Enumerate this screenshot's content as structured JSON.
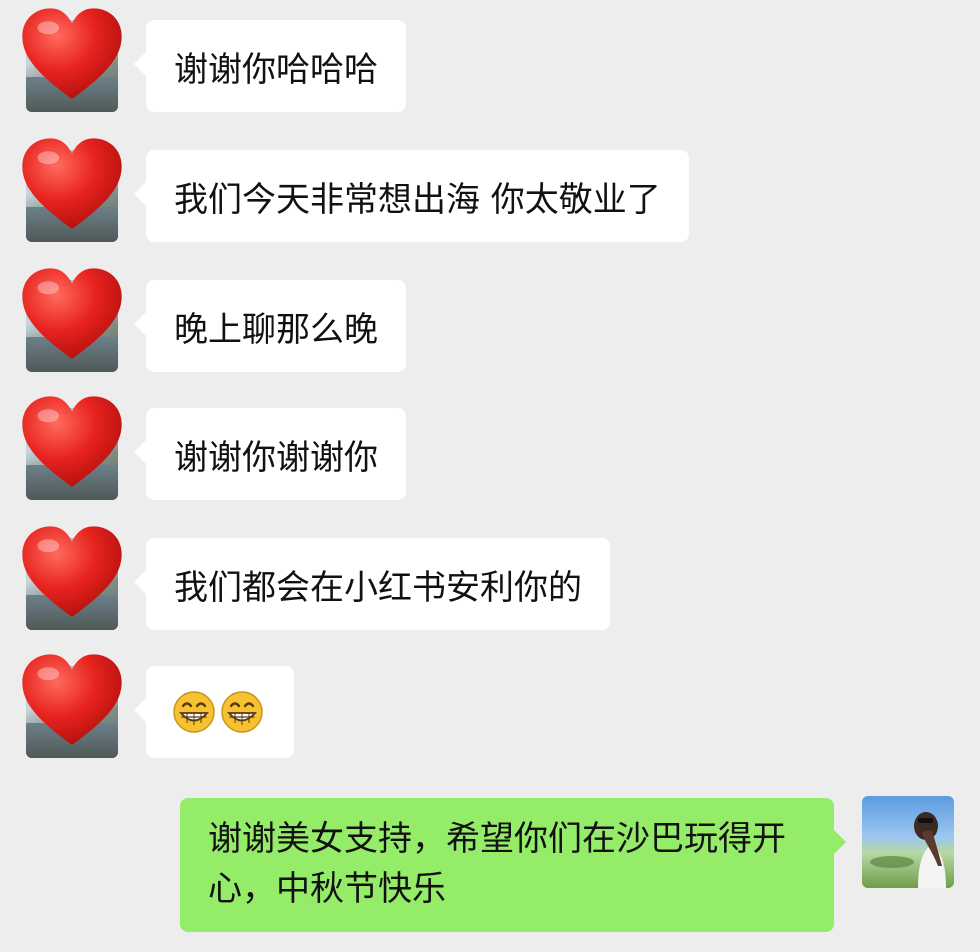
{
  "chat": {
    "incoming": [
      {
        "text": "谢谢你哈哈哈"
      },
      {
        "text": "我们今天非常想出海 你太敬业了"
      },
      {
        "text": "晚上聊那么晚"
      },
      {
        "text": "谢谢你谢谢你"
      },
      {
        "text": "我们都会在小红书安利你的"
      },
      {
        "text": "",
        "emoji": [
          "grinning-face-icon",
          "grinning-face-icon"
        ]
      }
    ],
    "outgoing": [
      {
        "text": "谢谢美女支持，希望你们在沙巴玩得开心，中秋节快乐"
      }
    ]
  },
  "colors": {
    "background": "#ededed",
    "incoming_bubble": "#ffffff",
    "outgoing_bubble": "#95ec69",
    "heart": "#e8231f"
  },
  "icons": {
    "incoming_avatar": "heart-icon",
    "emoji": "grinning-face-icon"
  }
}
